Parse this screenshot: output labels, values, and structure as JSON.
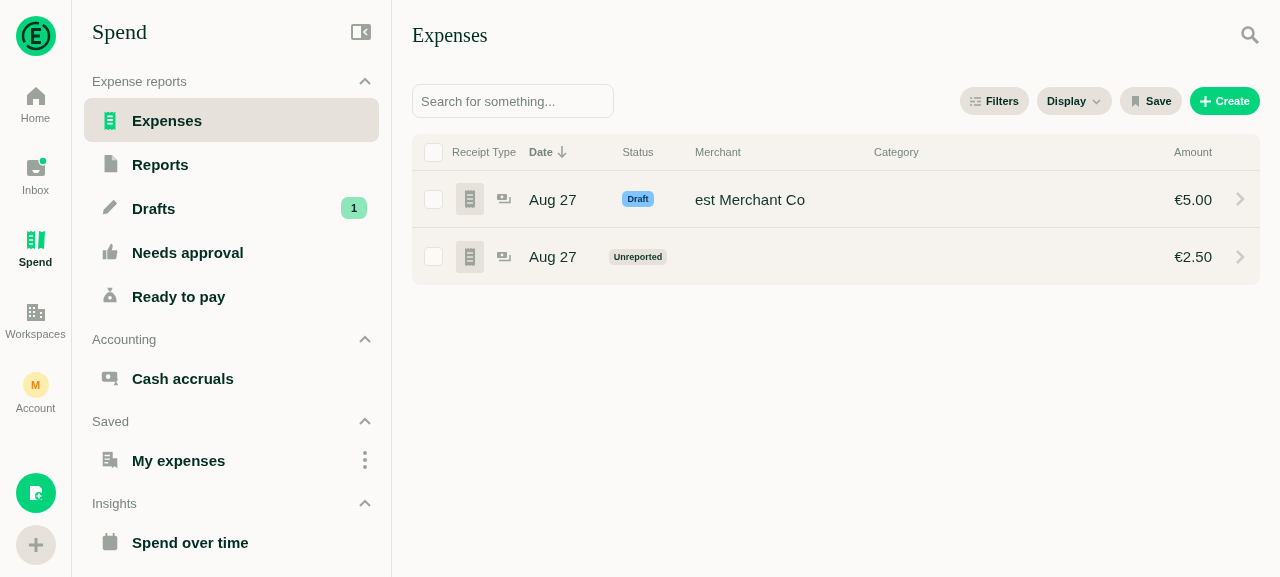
{
  "rail": {
    "items": [
      {
        "label": "Home",
        "kind": "icon",
        "selected": false,
        "dot": false
      },
      {
        "label": "Inbox",
        "kind": "icon",
        "selected": false,
        "dot": true
      },
      {
        "label": "Spend",
        "kind": "icon",
        "selected": true,
        "dot": false
      },
      {
        "label": "Workspaces",
        "kind": "icon",
        "selected": false,
        "dot": false
      },
      {
        "label": "Account",
        "kind": "avatar",
        "initial": "M",
        "selected": false,
        "dot": false
      }
    ]
  },
  "sidebar": {
    "title": "Spend",
    "sections": [
      {
        "title": "Expense reports",
        "expanded": true,
        "items": [
          {
            "label": "Expenses",
            "selected": true,
            "menu": false
          },
          {
            "label": "Reports",
            "selected": false,
            "menu": false
          },
          {
            "label": "Drafts",
            "selected": false,
            "badge": "1",
            "menu": false
          },
          {
            "label": "Needs approval",
            "selected": false,
            "menu": false
          },
          {
            "label": "Ready to pay",
            "selected": false,
            "menu": false
          }
        ]
      },
      {
        "title": "Accounting",
        "expanded": true,
        "items": [
          {
            "label": "Cash accruals",
            "selected": false,
            "menu": false
          }
        ]
      },
      {
        "title": "Saved",
        "expanded": true,
        "items": [
          {
            "label": "My expenses",
            "selected": false,
            "menu": true
          }
        ]
      },
      {
        "title": "Insights",
        "expanded": true,
        "items": [
          {
            "label": "Spend over time",
            "selected": false,
            "menu": false
          }
        ]
      }
    ]
  },
  "main": {
    "title": "Expenses",
    "search": {
      "placeholder": "Search for something..."
    },
    "buttons": [
      {
        "label": "Filters",
        "kind": "filters"
      },
      {
        "label": "Display",
        "kind": "display"
      },
      {
        "label": "Save",
        "kind": "save"
      },
      {
        "label": "Create",
        "kind": "create"
      }
    ],
    "table": {
      "all_checked": false,
      "columns": [
        {
          "label": "Receipt Type",
          "sorted": false
        },
        {
          "label": "Date",
          "sorted": true
        },
        {
          "label": "Status",
          "sorted": false
        },
        {
          "label": "Merchant",
          "sorted": false
        },
        {
          "label": "Category",
          "sorted": false
        },
        {
          "label": "Amount",
          "sorted": false
        }
      ],
      "rows": [
        {
          "checked": false,
          "date": "Aug 27",
          "status": {
            "label": "Draft",
            "kind": "draft"
          },
          "merchant": "est Merchant Co",
          "amount": "€5.00"
        },
        {
          "checked": false,
          "date": "Aug 27",
          "status": {
            "label": "Unreported",
            "kind": "unreported"
          },
          "merchant": "",
          "amount": "€2.50"
        }
      ]
    }
  }
}
